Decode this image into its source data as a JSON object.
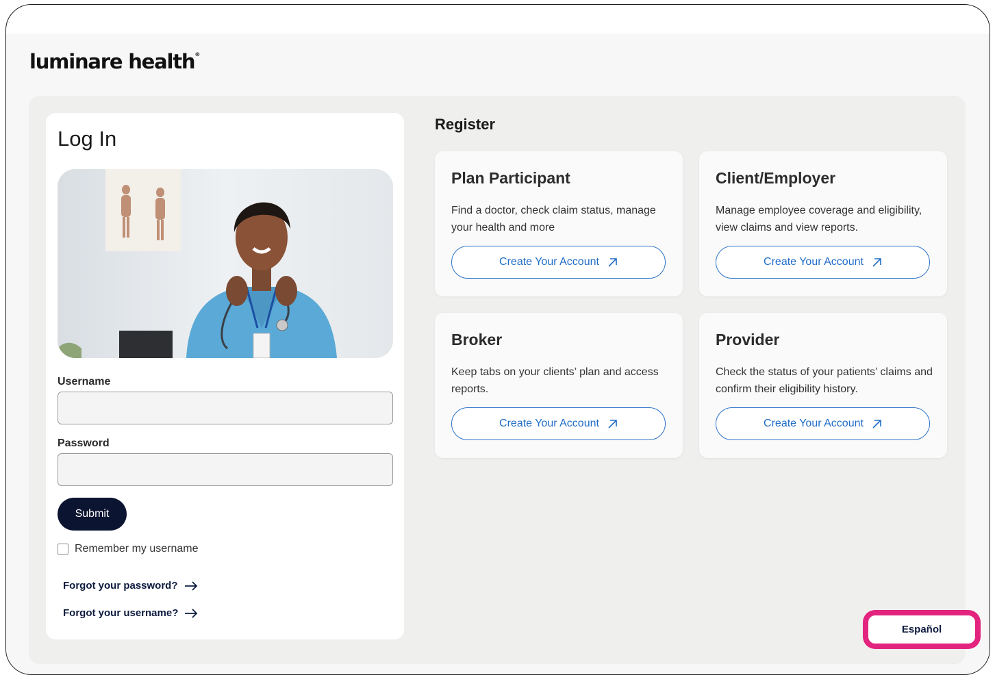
{
  "brand": {
    "logo_text": "luminare health",
    "logo_mark": "®"
  },
  "login": {
    "title": "Log In",
    "username_label": "Username",
    "username_value": "",
    "password_label": "Password",
    "password_value": "",
    "submit_label": "Submit",
    "remember_label": "Remember my username",
    "remember_checked": false,
    "forgot_password_label": "Forgot your password?",
    "forgot_username_label": "Forgot your username?"
  },
  "register": {
    "title": "Register",
    "cards": [
      {
        "title": "Plan Participant",
        "description": "Find a doctor, check claim status, manage your health and more",
        "button_label": "Create Your Account"
      },
      {
        "title": "Client/Employer",
        "description": "Manage employee coverage and eligibility, view claims and view reports.",
        "button_label": "Create Your Account"
      },
      {
        "title": "Broker",
        "description": "Keep tabs on your clients’ plan and access reports.",
        "button_label": "Create Your Account"
      },
      {
        "title": "Provider",
        "description": "Check the status of your patients’ claims and confirm their eligibility history.",
        "button_label": "Create Your Account"
      }
    ]
  },
  "language": {
    "label": "Español"
  },
  "icons": {
    "arrow": "arrow-right-icon",
    "external": "external-link-icon",
    "hero": "nurse-photo"
  },
  "colors": {
    "primary_dark": "#0b1430",
    "link_blue": "#1f6cc7",
    "highlight": "#e3247e"
  }
}
